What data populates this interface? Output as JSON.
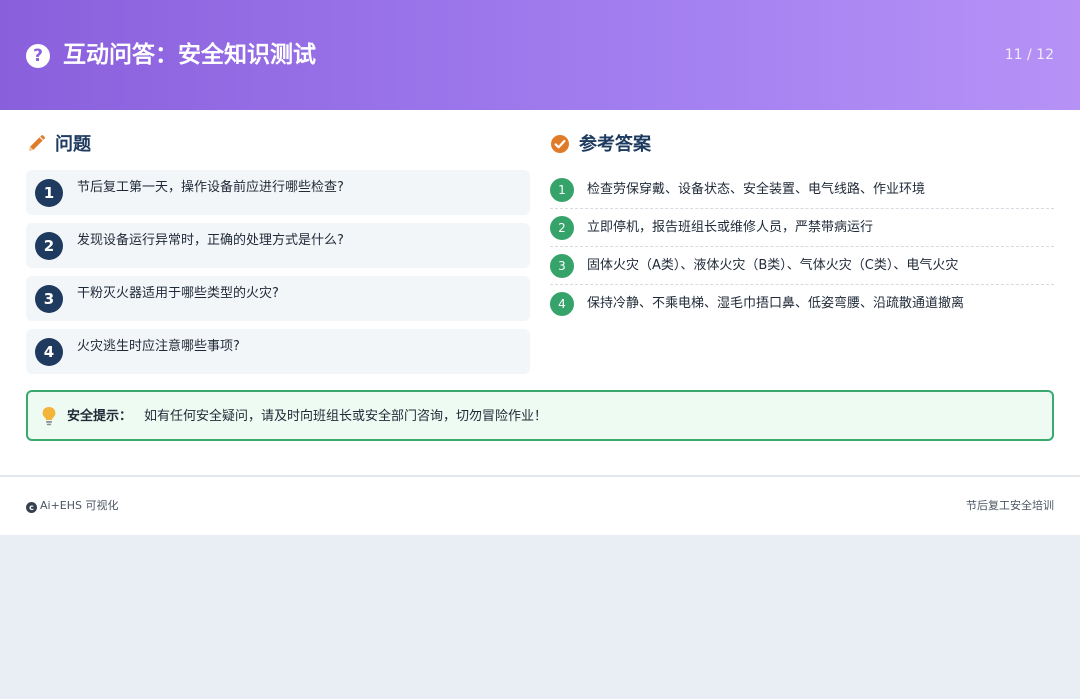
{
  "header": {
    "icon": "question-circle-icon",
    "title": "互动问答：安全知识测试",
    "page_indicator": "11 / 12"
  },
  "questions_section": {
    "icon": "pencil-icon",
    "title": "问题",
    "items": [
      {
        "number": "1",
        "text": "节后复工第一天，操作设备前应进行哪些检查?"
      },
      {
        "number": "2",
        "text": "发现设备运行异常时，正确的处理方式是什么?"
      },
      {
        "number": "3",
        "text": "干粉灭火器适用于哪些类型的火灾?"
      },
      {
        "number": "4",
        "text": "火灾逃生时应注意哪些事项?"
      }
    ]
  },
  "answers_section": {
    "icon": "check-circle-icon",
    "title": "参考答案",
    "items": [
      {
        "number": "1",
        "text": "检查劳保穿戴、设备状态、安全装置、电气线路、作业环境"
      },
      {
        "number": "2",
        "text": "立即停机，报告班组长或维修人员，严禁带病运行"
      },
      {
        "number": "3",
        "text": "固体火灾（A类）、液体火灾（B类）、气体火灾（C类）、电气火灾"
      },
      {
        "number": "4",
        "text": "保持冷静、不乘电梯、湿毛巾捂口鼻、低姿弯腰、沿疏散通道撤离"
      }
    ]
  },
  "safety_tip": {
    "icon": "lightbulb-icon",
    "label": "安全提示：",
    "text": "如有任何安全疑问，请及时向班组长或安全部门咨询，切勿冒险作业！"
  },
  "footer": {
    "left_icon": "copyright-icon",
    "left_text": "Ai+EHS 可视化",
    "right_text": "节后复工安全培训"
  },
  "colors": {
    "header_gradient_start": "#8a5fdc",
    "header_gradient_end": "#b692f6",
    "navy": "#1e3a5f",
    "green": "#35a36a",
    "orange": "#e07b2a",
    "tip_border": "#3aa96d"
  }
}
